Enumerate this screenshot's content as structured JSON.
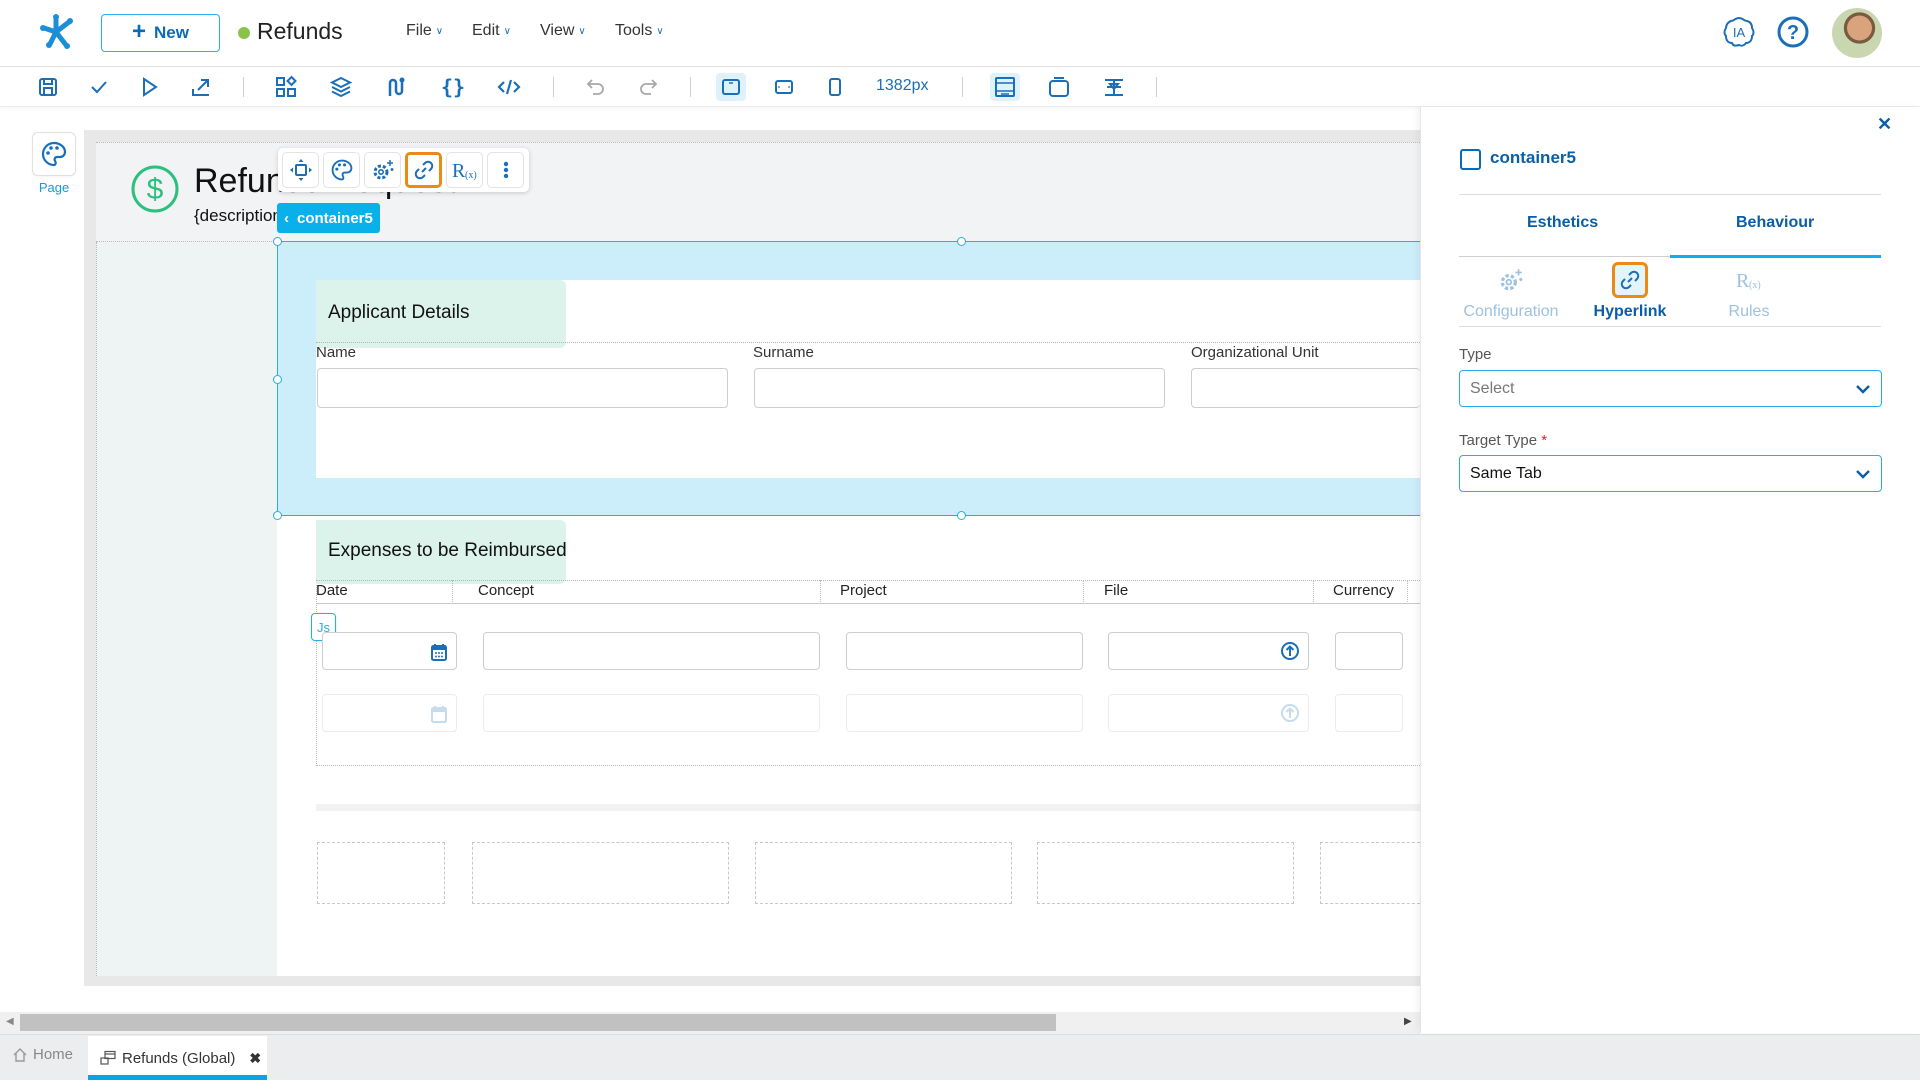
{
  "header": {
    "new_label": "New",
    "app_title": "Refunds",
    "status_color": "#8bc34a",
    "menus": [
      {
        "label": "File"
      },
      {
        "label": "Edit"
      },
      {
        "label": "View"
      },
      {
        "label": "Tools"
      }
    ],
    "ia_label": "IA"
  },
  "toolbar": {
    "width_label": "1382px",
    "icons": [
      "save-icon",
      "check-icon",
      "play-icon",
      "publish-icon",
      "components-icon",
      "layers-icon",
      "flow-icon",
      "braces-icon",
      "code-icon",
      "undo-icon",
      "redo-icon",
      "desktop-view-icon",
      "tablet-view-icon",
      "mobile-view-icon",
      "layout-icon",
      "container-icon",
      "align-icon"
    ]
  },
  "left_rail": {
    "page_label": "Page"
  },
  "canvas": {
    "page_title": "Refunds Request",
    "page_description": "{description}",
    "selected_chip": "container5",
    "float_toolbar": [
      "move-icon",
      "palette-icon",
      "config-icon",
      "link-icon",
      "rules-icon",
      "more-icon"
    ],
    "applicant": {
      "title": "Applicant Details",
      "fields": [
        "Name",
        "Surname",
        "Organizational Unit"
      ]
    },
    "expenses": {
      "title": "Expenses to be Reimbursed",
      "columns": [
        "Date",
        "Concept",
        "Project",
        "File",
        "Currency"
      ],
      "js_badge": "Js"
    }
  },
  "panel": {
    "component_name": "container5",
    "tabs": [
      {
        "label": "Esthetics",
        "active": false
      },
      {
        "label": "Behaviour",
        "active": true
      }
    ],
    "subtabs": [
      {
        "label": "Configuration",
        "active": false
      },
      {
        "label": "Hyperlink",
        "active": true
      },
      {
        "label": "Rules",
        "active": false
      }
    ],
    "type_label": "Type",
    "type_value": "Select",
    "target_label": "Target Type",
    "target_required": "*",
    "target_value": "Same Tab"
  },
  "bottom_tabs": {
    "home": "Home",
    "current": "Refunds (Global)"
  },
  "colors": {
    "accent": "#0ab0ea",
    "primary": "#0a5ea8",
    "highlight": "#ec8a16",
    "selection_fill": "#cbeefa",
    "section_head": "#dcf3ec"
  }
}
